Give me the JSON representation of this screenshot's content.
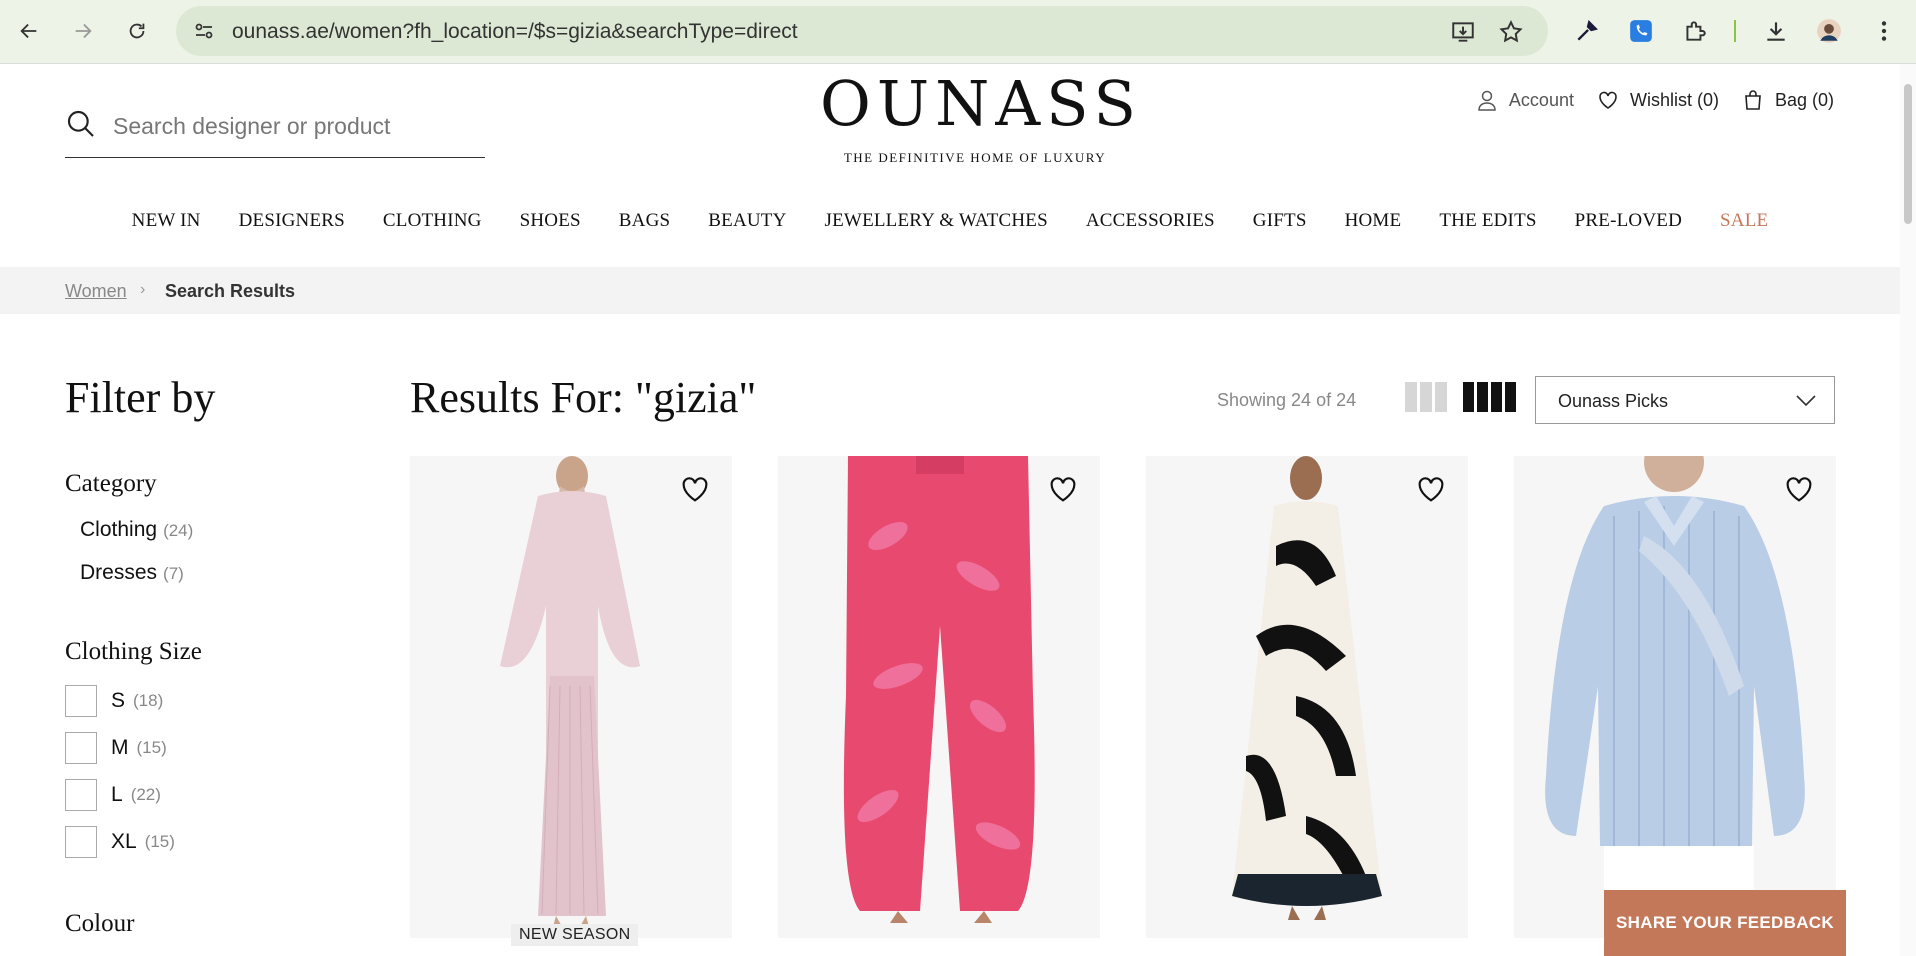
{
  "browser": {
    "url": "ounass.ae/women?fh_location=/$s=gizia&searchType=direct"
  },
  "header": {
    "search_placeholder": "Search designer or product",
    "brand": "OUNASS",
    "tagline": "THE DEFINITIVE HOME OF LUXURY",
    "account": "Account",
    "wishlist": "Wishlist (0)",
    "bag": "Bag (0)"
  },
  "menu": [
    "NEW IN",
    "DESIGNERS",
    "CLOTHING",
    "SHOES",
    "BAGS",
    "BEAUTY",
    "JEWELLERY & WATCHES",
    "ACCESSORIES",
    "GIFTS",
    "HOME",
    "THE EDITS",
    "PRE-LOVED",
    "SALE"
  ],
  "breadcrumb": {
    "home": "Women",
    "current": "Search Results"
  },
  "filters": {
    "title": "Filter by",
    "category_title": "Category",
    "categories": [
      {
        "label": "Clothing",
        "count": "(24)"
      },
      {
        "label": "Dresses",
        "count": "(7)"
      }
    ],
    "size_title": "Clothing Size",
    "sizes": [
      {
        "label": "S",
        "count": "(18)"
      },
      {
        "label": "M",
        "count": "(15)"
      },
      {
        "label": "L",
        "count": "(22)"
      },
      {
        "label": "XL",
        "count": "(15)"
      }
    ],
    "colour_title": "Colour"
  },
  "results": {
    "title": "Results For: \"gizia\"",
    "showing": "Showing 24 of 24",
    "sort_value": "Ounass Picks",
    "badge": "NEW SEASON"
  },
  "feedback": "SHARE YOUR FEEDBACK",
  "colors": {
    "accent": "#c4785a",
    "omnibox": "#dde8d4",
    "chrome": "#eef3e8"
  }
}
